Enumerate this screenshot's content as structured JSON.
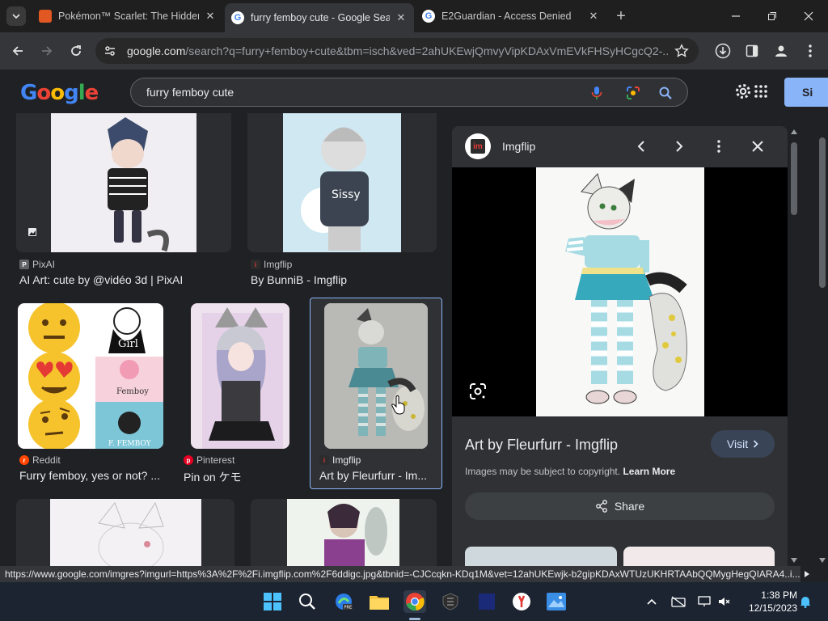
{
  "browser": {
    "tabs": [
      {
        "title": "Pokémon™ Scarlet: The Hidden",
        "favicon": "game-icon"
      },
      {
        "title": "furry femboy cute - Google Sea",
        "favicon": "google-icon",
        "active": true
      },
      {
        "title": "E2Guardian - Access Denied",
        "favicon": "google-icon"
      }
    ],
    "url_host": "google.com",
    "url_rest": "/search?q=furry+femboy+cute&tbm=isch&ved=2ahUKEwjQmvyVipKDAxVmEVkFHSyHCgcQ2-..."
  },
  "google": {
    "search_query": "furry femboy cute",
    "signin_label": "Si"
  },
  "results": [
    {
      "source": "PixAI",
      "caption": "AI Art: cute by @vidéo 3d | PixAI",
      "source_icon_color": "#5f6368"
    },
    {
      "source": "Imgflip",
      "caption": "By BunniB - Imgflip",
      "source_icon_color": "#e53935"
    },
    {
      "source": "Reddit",
      "caption": "Furry femboy, yes or not? ...",
      "source_icon_color": "#ff4500"
    },
    {
      "source": "Pinterest",
      "caption": "Pin on ケモ",
      "source_icon_color": "#e60023"
    },
    {
      "source": "Imgflip",
      "caption": "Art by Fleurfurr - Im...",
      "source_icon_color": "#e53935"
    }
  ],
  "thumb_texts": {
    "girl": "Girl",
    "femboy": "Femboy",
    "f_femboy": "F. FEMBOY",
    "sissy": "Sissy"
  },
  "panel": {
    "site": "Imgflip",
    "title": "Art by Fleurfurr - Imgflip",
    "visit_label": "Visit",
    "copyright_text": "Images may be subject to copyright.",
    "learn_more": "Learn More",
    "share_label": "Share"
  },
  "status_url": "https://www.google.com/imgres?imgurl=https%3A%2F%2Fi.imgflip.com%2F6ddigc.jpg&tbnid=-CJCcqkn-KDq1M&vet=12ahUKEwjk-b2gipKDAxWTUzUKHRTAAbQQMygHegQIARA4..i...",
  "taskbar": {
    "time": "1:38 PM",
    "date": "12/15/2023"
  },
  "colors": {
    "accent": "#8ab4f8",
    "page_bg": "#202124",
    "panel_bg": "#303134"
  }
}
